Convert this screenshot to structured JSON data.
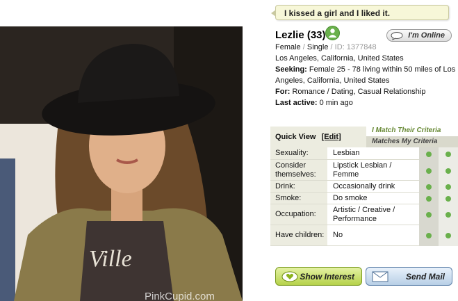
{
  "profile": {
    "tagline": "I kissed a girl and I liked it.",
    "name": "Lezlie (33)",
    "status_button": "I'm Online",
    "gender": "Female",
    "relationship": "Single",
    "id_text": "ID: 1377848",
    "location": "Los Angeles, California, United States",
    "seeking_label": "Seeking:",
    "seeking_text_1": "Female 25 - 78 living within 50 miles of Los",
    "seeking_text_2": "Angeles, California, United States",
    "for_label": "For:",
    "for_text": "Romance / Dating, Casual Relationship",
    "last_active_label": "Last active:",
    "last_active_text": "0 min ago",
    "watermark": "PinkCupid.com"
  },
  "quick_view": {
    "title": "Quick View",
    "edit_label": "[Edit]",
    "criteria_1": "I Match Their Criteria",
    "criteria_2": "Matches My Criteria",
    "rows": [
      {
        "label": "Sexuality:",
        "value": "Lesbian"
      },
      {
        "label": "Consider themselves:",
        "value": "Lipstick Lesbian / Femme"
      },
      {
        "label": "Drink:",
        "value": "Occasionally drink"
      },
      {
        "label": "Smoke:",
        "value": "Do smoke"
      },
      {
        "label": "Occupation:",
        "value": "Artistic / Creative / Performance"
      },
      {
        "label": "Have children:",
        "value": "No"
      }
    ]
  },
  "actions": {
    "show_interest": "Show Interest",
    "send_mail": "Send Mail"
  },
  "colors": {
    "match_dot": "#6ab04c",
    "interest_button": "#b6d24a",
    "mail_button": "#b8cfe6"
  }
}
